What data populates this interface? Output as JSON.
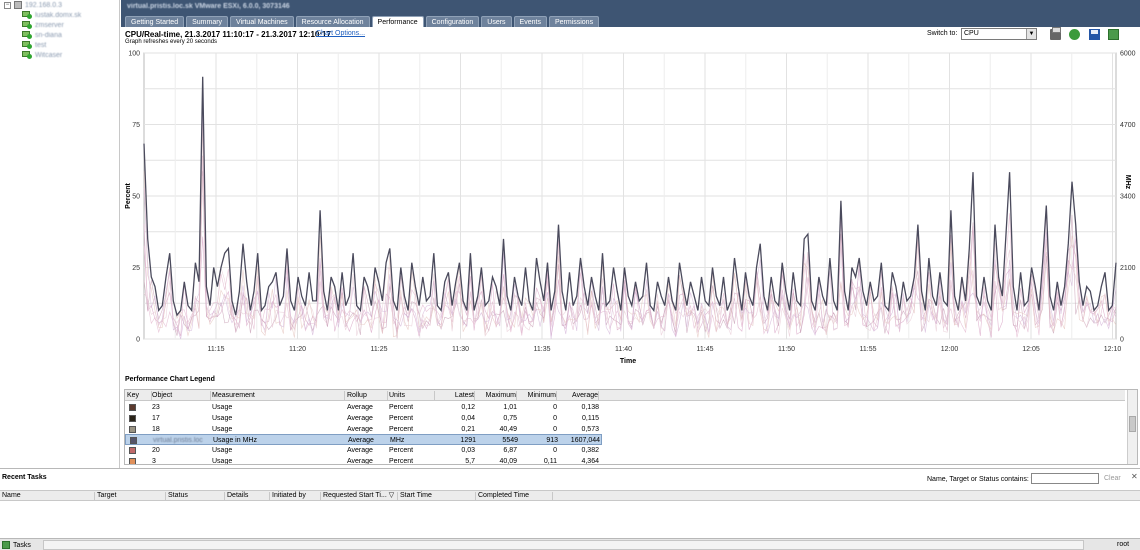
{
  "tree": {
    "host": "192.168.0.3",
    "vms": [
      "lustak.domx.sk",
      "zmserver",
      "sn-diana",
      "test",
      "Witcaser"
    ]
  },
  "header": {
    "host_title": "virtual.pristis.loc.sk VMware ESXi, 6.0.0, 3073146",
    "tabs": [
      "Getting Started",
      "Summary",
      "Virtual Machines",
      "Resource Allocation",
      "Performance",
      "Configuration",
      "Users",
      "Events",
      "Permissions"
    ],
    "active_tab": "Performance"
  },
  "perf": {
    "title": "CPU/Real-time, 21.3.2017 11:10:17 - 21.3.2017 12:10:17",
    "chart_options": "Chart Options...",
    "refresh_note": "Graph refreshes every 20 seconds",
    "switch_label": "Switch to:",
    "switch_value": "CPU",
    "legend_title": "Performance Chart Legend"
  },
  "colors": {
    "header_bg": "#3e5573",
    "main_series": "#4a4a5c",
    "selected_row": "#bcd2ea"
  },
  "legend": {
    "columns": [
      "Key",
      "Object",
      "Measurement",
      "Rollup",
      "Units",
      "Latest",
      "Maximum",
      "Minimum",
      "Average"
    ],
    "rows": [
      {
        "color": "#5c3a2e",
        "object": "23",
        "measurement": "Usage",
        "rollup": "Average",
        "units": "Percent",
        "latest": "0,12",
        "maximum": "1,01",
        "minimum": "0",
        "average": "0,138"
      },
      {
        "color": "#2a2418",
        "object": "17",
        "measurement": "Usage",
        "rollup": "Average",
        "units": "Percent",
        "latest": "0,04",
        "maximum": "0,75",
        "minimum": "0",
        "average": "0,115"
      },
      {
        "color": "#9a9484",
        "object": "18",
        "measurement": "Usage",
        "rollup": "Average",
        "units": "Percent",
        "latest": "0,21",
        "maximum": "40,49",
        "minimum": "0",
        "average": "0,573"
      },
      {
        "color": "#54546a",
        "object": "virtual.pristis.loc",
        "measurement": "Usage in MHz",
        "rollup": "Average",
        "units": "MHz",
        "latest": "1291",
        "maximum": "5549",
        "minimum": "913",
        "average": "1607,044",
        "selected": true
      },
      {
        "color": "#c06a6a",
        "object": "20",
        "measurement": "Usage",
        "rollup": "Average",
        "units": "Percent",
        "latest": "0,03",
        "maximum": "6,87",
        "minimum": "0",
        "average": "0,382"
      },
      {
        "color": "#e0905a",
        "object": "3",
        "measurement": "Usage",
        "rollup": "Average",
        "units": "Percent",
        "latest": "5,7",
        "maximum": "40,09",
        "minimum": "0,11",
        "average": "4,364"
      }
    ]
  },
  "tasks": {
    "title": "Recent Tasks",
    "filter_label": "Name, Target or Status contains: ▾",
    "clear_label": "Clear",
    "close_glyph": "✕",
    "columns": [
      "Name",
      "Target",
      "Status",
      "Details",
      "Initiated by",
      "Requested Start Ti... ▽",
      "Start Time",
      "Completed Time"
    ]
  },
  "statusbar": {
    "tasks_button": "Tasks",
    "user": "root"
  },
  "chart_data": {
    "type": "line",
    "xlabel": "Time",
    "ylabel": "Percent",
    "y2label": "MHz",
    "ylim": [
      0,
      100
    ],
    "y2lim": [
      0,
      6000
    ],
    "yticks": [
      "0",
      "25",
      "50",
      "75",
      "100"
    ],
    "y2ticks": [
      "0",
      "2100",
      "3400",
      "4700",
      "6000"
    ],
    "xticks": [
      "11:15",
      "11:20",
      "11:25",
      "11:30",
      "11:35",
      "11:40",
      "11:45",
      "11:50",
      "11:55",
      "12:00",
      "12:05",
      "12:10"
    ],
    "grid": true,
    "series": [
      {
        "name": "virtual.pristis.loc Usage in MHz",
        "axis": "right",
        "values": [
          4100,
          2100,
          1300,
          1100,
          600,
          700,
          1300,
          1800,
          800,
          500,
          600,
          1200,
          700,
          600,
          1600,
          1200,
          5500,
          1100,
          700,
          1500,
          1100,
          1500,
          1800,
          1900,
          800,
          500,
          1000,
          2000,
          1200,
          600,
          1000,
          1800,
          600,
          700,
          1100,
          1200,
          1400,
          700,
          900,
          1900,
          800,
          600,
          1300,
          900,
          700,
          1400,
          800,
          800,
          2700,
          1000,
          600,
          1300,
          1100,
          600,
          1400,
          700,
          900,
          1800,
          700,
          600,
          1300,
          1100,
          700,
          1500,
          1200,
          800,
          1600,
          1900,
          800,
          600,
          1500,
          900,
          600,
          1600,
          1100,
          700,
          1300,
          800,
          900,
          1800,
          700,
          600,
          1200,
          1400,
          700,
          1200,
          1600,
          800,
          600,
          1800,
          600,
          900,
          1500,
          700,
          800,
          1300,
          1100,
          700,
          2100,
          900,
          600,
          1300,
          900,
          700,
          1500,
          800,
          600,
          1700,
          1200,
          800,
          1600,
          600,
          1000,
          2400,
          1000,
          600,
          1400,
          700,
          900,
          1700,
          1100,
          700,
          1300,
          900,
          600,
          1800,
          700,
          800,
          1500,
          1000,
          600,
          1500,
          900,
          700,
          1200,
          800,
          900,
          1600,
          700,
          600,
          1200,
          900,
          700,
          1300,
          800,
          600,
          1600,
          1100,
          700,
          1200,
          900,
          600,
          1300,
          800,
          700,
          1500,
          900,
          700,
          1300,
          600,
          800,
          1700,
          1100,
          600,
          1400,
          900,
          700,
          1500,
          2000,
          900,
          600,
          1300,
          800,
          700,
          1600,
          1000,
          600,
          1400,
          800,
          700,
          2100,
          2200,
          800,
          600,
          1300,
          900,
          700,
          1700,
          800,
          600,
          2900,
          1000,
          600,
          1500,
          1300,
          1700,
          1000,
          700,
          1200,
          800,
          900,
          1600,
          700,
          600,
          1400,
          1100,
          600,
          1200,
          800,
          900,
          1300,
          2400,
          1000,
          600,
          1700,
          900,
          700,
          1400,
          800,
          700,
          2700,
          900,
          600,
          1300,
          800,
          1900,
          3500,
          900,
          700,
          1300,
          800,
          600,
          2400,
          1300,
          900,
          2200,
          3500,
          1100,
          600,
          1400,
          700,
          800,
          1500,
          1100,
          600,
          1600,
          2800,
          900,
          600,
          1200,
          700,
          1100,
          2000,
          3300,
          2400,
          1200,
          700,
          1100,
          1000,
          600,
          700,
          1100,
          1400,
          600,
          700,
          1600
        ]
      }
    ]
  }
}
